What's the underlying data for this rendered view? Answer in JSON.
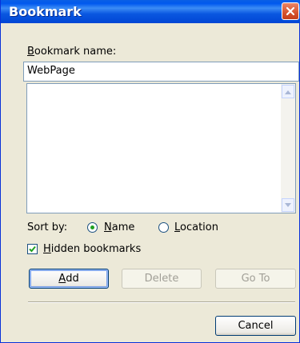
{
  "window": {
    "title": "Bookmark"
  },
  "form": {
    "name_label": "Bookmark name:",
    "name_value": "WebPage",
    "sort_label": "Sort by:",
    "sort_options": [
      "Name",
      "Location"
    ],
    "sort_selected": "Name",
    "hidden_bookmarks_label": "Hidden bookmarks",
    "hidden_bookmarks_checked": true
  },
  "buttons": {
    "add": "Add",
    "delete": "Delete",
    "goto": "Go To",
    "cancel": "Cancel"
  },
  "icons": {
    "close": "close-icon",
    "scroll_up": "scroll-up-icon",
    "scroll_down": "scroll-down-icon",
    "check": "check-icon"
  },
  "colors": {
    "titlebar": "#0058ee",
    "dialog_bg": "#ece9d8",
    "close_button": "#d6532e",
    "radio_dot": "#21a121"
  }
}
